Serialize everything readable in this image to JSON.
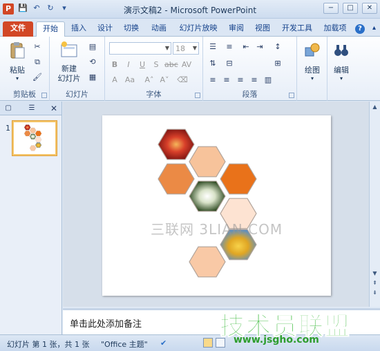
{
  "window": {
    "app_letter": "P",
    "title": "演示文稿2 - Microsoft PowerPoint",
    "buttons": [
      "−",
      "□",
      "✕"
    ]
  },
  "quick_access": [
    "save-icon",
    "undo-icon",
    "redo-icon",
    "customize-icon"
  ],
  "tabs": [
    {
      "label": "文件",
      "type": "file"
    },
    {
      "label": "开始",
      "type": "active"
    },
    {
      "label": "插入"
    },
    {
      "label": "设计"
    },
    {
      "label": "切换"
    },
    {
      "label": "动画"
    },
    {
      "label": "幻灯片放映"
    },
    {
      "label": "审阅"
    },
    {
      "label": "视图"
    },
    {
      "label": "开发工具"
    },
    {
      "label": "加载项"
    }
  ],
  "ribbon": {
    "clipboard": {
      "paste_label": "粘贴",
      "group_label": "剪贴板"
    },
    "slides": {
      "new_slide_label": "新建\n幻灯片",
      "group_label": "幻灯片"
    },
    "font": {
      "font_name": "",
      "font_size": "18",
      "group_label": "字体"
    },
    "paragraph": {
      "group_label": "段落"
    },
    "drawing": {
      "label": "绘图"
    },
    "editing": {
      "label": "编辑"
    }
  },
  "slides_panel": {
    "slide_number": "1"
  },
  "slide": {
    "hexagons": [
      {
        "color": "#c0392b",
        "kind": "photo-red"
      },
      {
        "color": "#f7c39b",
        "kind": "fill"
      },
      {
        "color": "#eb8a45",
        "kind": "fill"
      },
      {
        "color": "#3d6b2d",
        "kind": "photo-white"
      },
      {
        "color": "#e9721a",
        "kind": "fill"
      },
      {
        "color": "#fde3d2",
        "kind": "fill"
      },
      {
        "color": "#d9a42a",
        "kind": "photo-yellow"
      },
      {
        "color": "#f9c9a6",
        "kind": "fill"
      }
    ]
  },
  "notes": {
    "placeholder": "单击此处添加备注"
  },
  "status": {
    "slide_info": "幻灯片 第 1 张，共 1 张",
    "theme": "\"Office 主题\""
  },
  "watermarks": {
    "center": "三联网 3LIAN.COM",
    "logo": "技术员联盟",
    "url": "www.jsgho.com"
  },
  "colors": {
    "file_tab": "#d24726",
    "accent": "#2a6fc8"
  }
}
